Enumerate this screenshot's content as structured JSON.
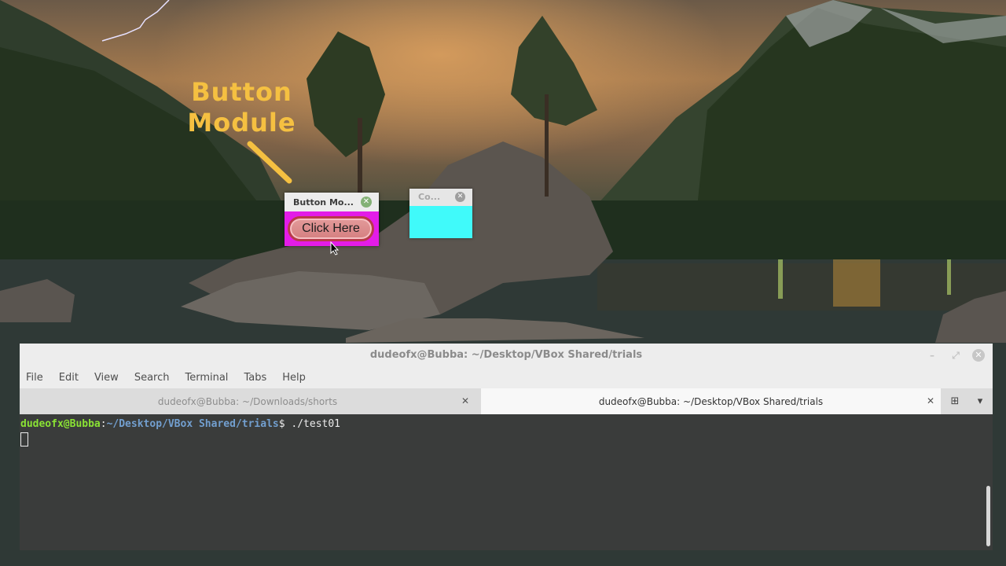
{
  "desktop": {
    "annotation": [
      "Button",
      "Module"
    ]
  },
  "button_window": {
    "title": "Button Mo...",
    "button_label": "Click Here",
    "colors": {
      "body": "#e31ce8",
      "button": "#d57f80"
    }
  },
  "co_window": {
    "title": "Co...",
    "colors": {
      "body": "#40fafa"
    }
  },
  "terminal": {
    "title": "dudeofx@Bubba: ~/Desktop/VBox Shared/trials",
    "menu": [
      "File",
      "Edit",
      "View",
      "Search",
      "Terminal",
      "Tabs",
      "Help"
    ],
    "tabs": [
      {
        "label": "dudeofx@Bubba: ~/Downloads/shorts",
        "active": false
      },
      {
        "label": "dudeofx@Bubba: ~/Desktop/VBox Shared/trials",
        "active": true
      }
    ],
    "prompt_user": "dudeofx@Bubba",
    "prompt_sep": ":",
    "prompt_path": "~/Desktop/VBox Shared/trials",
    "prompt_symbol": "$ ",
    "command": "./test01"
  }
}
